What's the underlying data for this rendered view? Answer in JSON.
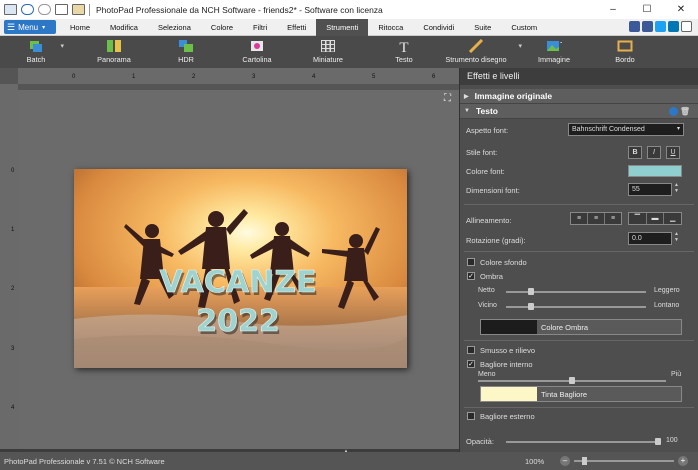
{
  "titlebar": {
    "title": "PhotoPad Professionale da NCH Software - friends2* - Software con licenza",
    "minimize": "–",
    "maximize": "☐",
    "close": "✕"
  },
  "menubar": {
    "menu_label": "Menu",
    "tabs": [
      "Home",
      "Modifica",
      "Seleziona",
      "Colore",
      "Filtri",
      "Effetti",
      "Strumenti",
      "Ritocca",
      "Condividi",
      "Suite",
      "Custom"
    ],
    "active_tab": "Strumenti"
  },
  "toolbar": {
    "tools": [
      {
        "label": "Batch",
        "icon": "batch-icon"
      },
      {
        "label": "Panorama",
        "icon": "panorama-icon"
      },
      {
        "label": "HDR",
        "icon": "hdr-icon"
      },
      {
        "label": "Cartolina",
        "icon": "postcard-icon"
      },
      {
        "label": "Miniature",
        "icon": "thumbnails-icon"
      },
      {
        "label": "Testo",
        "icon": "text-icon"
      },
      {
        "label": "Strumento disegno",
        "icon": "pen-icon"
      },
      {
        "label": "Immagine",
        "icon": "image-icon"
      },
      {
        "label": "Bordo",
        "icon": "border-icon"
      }
    ]
  },
  "rulers": {
    "h_ticks": [
      "0",
      "1",
      "2",
      "3",
      "4",
      "5",
      "6"
    ],
    "v_ticks": [
      "0",
      "1",
      "2",
      "3",
      "4"
    ]
  },
  "image": {
    "line1": "VACANZE",
    "line2": "2022"
  },
  "panel": {
    "header": "Effetti e livelli",
    "sec_original": "Immagine originale",
    "sec_text": "Testo",
    "font_aspect_label": "Aspetto font:",
    "font_aspect_value": "Bahnschrift Condensed",
    "font_style_label": "Stile font:",
    "bold": "B",
    "italic": "I",
    "underline": "U",
    "font_color_label": "Colore font:",
    "font_color": "#8fcfcf",
    "font_size_label": "Dimensioni font:",
    "font_size_value": "55",
    "alignment_label": "Allineamento:",
    "rotation_label": "Rotazione (gradi):",
    "rotation_value": "0.0",
    "bg_color_label": "Colore sfondo",
    "shadow_label": "Ombra",
    "shadow_checked": "✓",
    "sharp_label": "Netto",
    "soft_label": "Leggero",
    "near_label": "Vicino",
    "far_label": "Lontano",
    "shadow_sharpness": 0.18,
    "shadow_distance": 0.18,
    "shadow_color_label": "Colore Ombra",
    "shadow_color": "#1c1c1c",
    "emboss_label": "Smusso e rilievo",
    "inner_glow_label": "Bagliore interno",
    "inner_glow_checked": "✓",
    "less_label": "Meno",
    "more_label": "Più",
    "inner_glow_amount": 0.5,
    "glow_color_label": "Tinta Bagliore",
    "glow_color": "#fdf7c8",
    "outer_glow_label": "Bagliore esterno",
    "opacity_label": "Opacità:",
    "opacity_value": "100",
    "opacity_level": 1.0
  },
  "statusbar": {
    "version": "PhotoPad Professionale v 7.51 © NCH Software",
    "zoom": "100%",
    "zoom_minus": "–",
    "zoom_plus": "+"
  }
}
